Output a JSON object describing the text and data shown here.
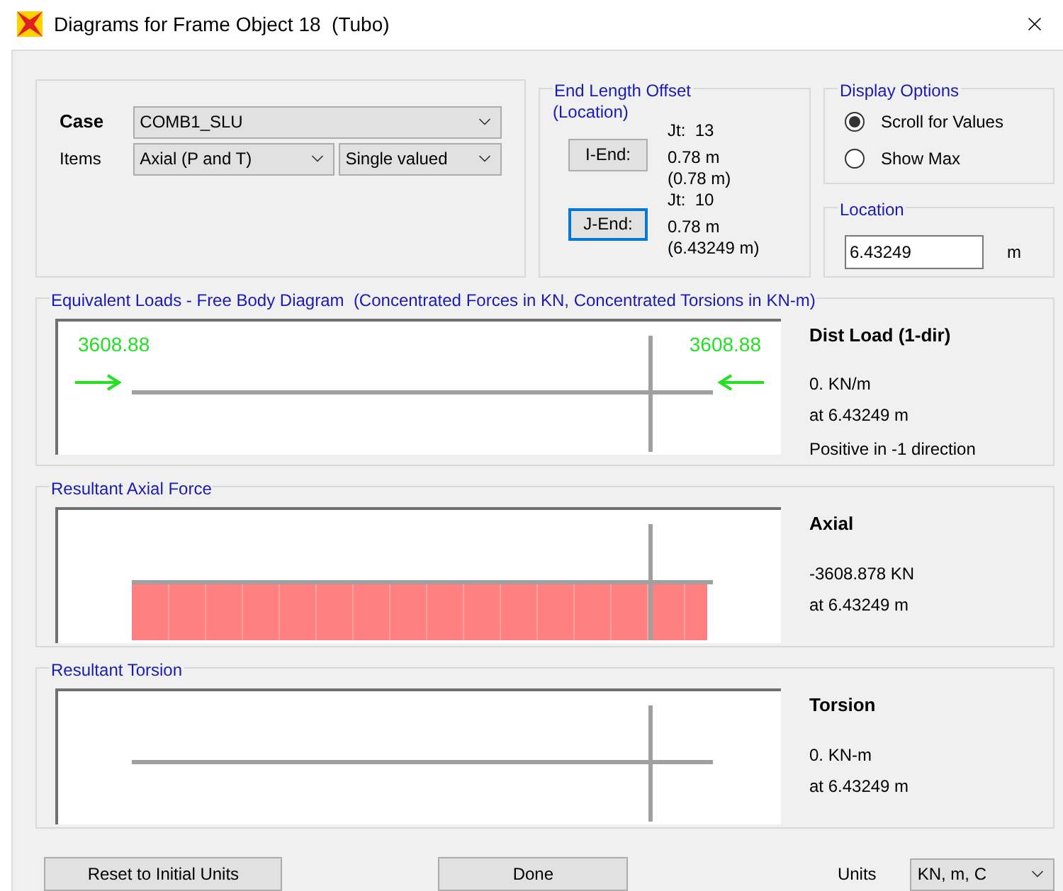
{
  "window": {
    "title": "Diagrams for Frame Object 18  (Tubo)"
  },
  "case_group": {
    "case_label": "Case",
    "case_value": "COMB1_SLU",
    "items_label": "Items",
    "items_value": "Axial (P and T)",
    "mode_value": "Single valued"
  },
  "end_length_offset": {
    "title": "End Length Offset",
    "subtitle": "(Location)",
    "ends": [
      {
        "button": "I-End:",
        "focused": false,
        "joint": "Jt:  13",
        "offset": "0.78 m",
        "location": "(0.78 m)"
      },
      {
        "button": "J-End:",
        "focused": true,
        "joint": "Jt:  10",
        "offset": "0.78 m",
        "location": "(6.43249 m)"
      }
    ]
  },
  "display_options": {
    "title": "Display Options",
    "options": [
      {
        "label": "Scroll for Values",
        "selected": true
      },
      {
        "label": "Show Max",
        "selected": false
      }
    ]
  },
  "location": {
    "title": "Location",
    "value": "6.43249",
    "unit": "m"
  },
  "panels": [
    {
      "kind": "loads",
      "title": "Equivalent Loads - Free Body Diagram  (Concentrated Forces in KN, Concentrated Torsions in KN-m)",
      "left_force": "3608.88",
      "right_force": "3608.88",
      "heading": "Dist Load (1-dir)",
      "lines": [
        "0. KN/m",
        "at 6.43249 m"
      ],
      "note": "Positive in -1 direction"
    },
    {
      "kind": "filled",
      "title": "Resultant Axial Force",
      "heading": "Axial",
      "lines": [
        "-3608.878 KN",
        "at 6.43249 m"
      ]
    },
    {
      "kind": "empty",
      "title": "Resultant Torsion",
      "heading": "Torsion",
      "lines": [
        "0. KN-m",
        "at 6.43249 m"
      ]
    }
  ],
  "footer": {
    "reset_button": "Reset to Initial Units",
    "done_button": "Done",
    "units_label": "Units",
    "units_value": "KN, m, C"
  }
}
